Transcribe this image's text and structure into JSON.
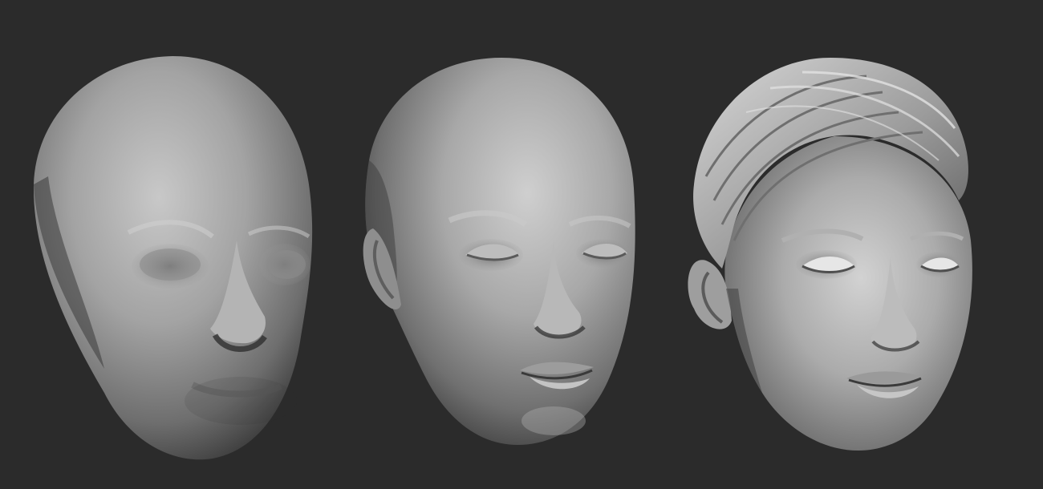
{
  "scene": {
    "background_color": "#2b2b2b",
    "clay_color": "#9a9a9a",
    "subjects": [
      {
        "icon": "head-sculpt-blockout-icon"
      },
      {
        "icon": "head-sculpt-refined-icon"
      },
      {
        "icon": "head-sculpt-detailed-hair-icon"
      }
    ]
  }
}
